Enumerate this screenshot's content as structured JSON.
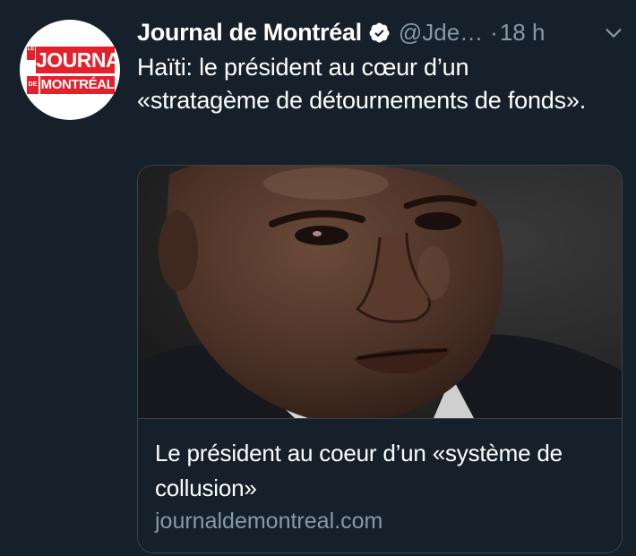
{
  "tweet": {
    "author": {
      "display_name": "Journal de Montréal",
      "handle": "@Jde…",
      "verified": true,
      "avatar_logo": {
        "le": "LE",
        "journal": "JOURNAL",
        "de": "DE",
        "montreal": "MONTRÉAL"
      }
    },
    "separator": "·",
    "time": "18 h",
    "text": "Haïti: le président au cœur d’un «stratagème de détournements de fonds».",
    "card": {
      "title": "Le président au coeur d’un «système de collusion»",
      "domain": "journaldemontreal.com"
    },
    "menu_icon": "chevron-down-icon"
  },
  "colors": {
    "background": "#15202b",
    "text_primary": "#ffffff",
    "text_secondary": "#8899a6",
    "border": "#38444d",
    "brand_red": "#e4212b"
  }
}
